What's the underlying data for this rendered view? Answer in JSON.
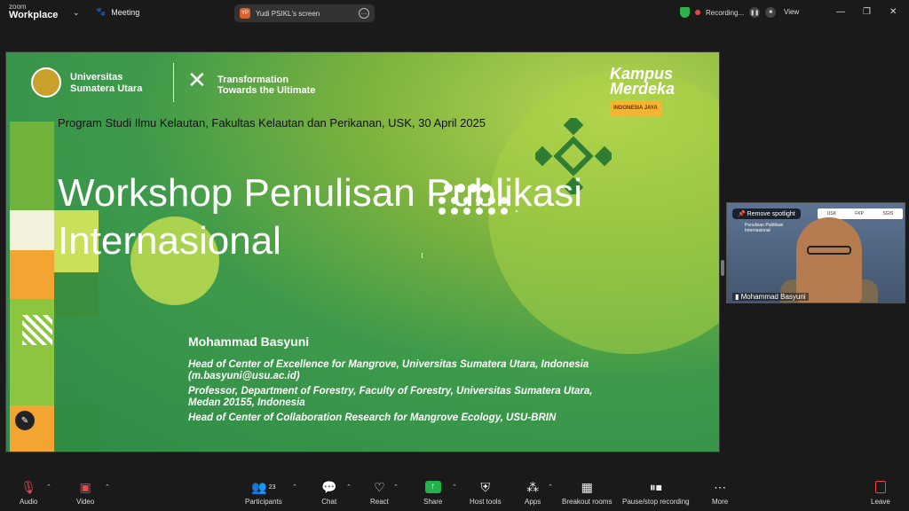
{
  "app": {
    "brand_small": "zoom",
    "brand": "Workplace",
    "meeting_label": "Meeting"
  },
  "share": {
    "initials": "YP",
    "title": "Yudi PSIKL's screen"
  },
  "recording": {
    "label": "Recording...",
    "view_label": "View"
  },
  "slide": {
    "university": "Universitas\nSumatera Utara",
    "tagline": "Transformation\nTowards the Ultimate",
    "kampus": "Kampus\nMerdeka",
    "kampus_tag": "INDONESIA JAYA",
    "program": "Program Studi Ilmu Kelautan, Fakultas Kelautan dan Perikanan, USK, 30 April 2025",
    "title": "Workshop Penulisan Publikasi\nInternasional",
    "speaker_name": "Mohammad Basyuni",
    "speaker_lines": [
      "Head of Center of Excellence for Mangrove, Universitas Sumatera Utara, Indonesia\n(m.basyuni@usu.ac.id)",
      "Professor, Department of Forestry, Faculty of Forestry, Universitas Sumatera Utara,\nMedan 20155, Indonesia",
      "Head of Center of Collaboration Research for Mangrove Ecology, USU-BRIN"
    ]
  },
  "video": {
    "spotlight": "Remove spotlight",
    "name": "Mohammad Basyuni",
    "slide_title": "Penulisan Publikasi\nInternasional",
    "logos": [
      "USK",
      "FKP",
      "SGIS"
    ]
  },
  "toolbar": {
    "audio": "Audio",
    "video": "Video",
    "participants": "Participants",
    "participants_count": "23",
    "chat": "Chat",
    "react": "React",
    "share": "Share",
    "host_tools": "Host tools",
    "apps": "Apps",
    "breakout": "Breakout rooms",
    "pause_recording": "Pause/stop recording",
    "more": "More",
    "leave": "Leave"
  },
  "colors": {
    "accent_green": "#22b14c",
    "record_red": "#e5484d",
    "slide_green": "#3e9a4a"
  }
}
